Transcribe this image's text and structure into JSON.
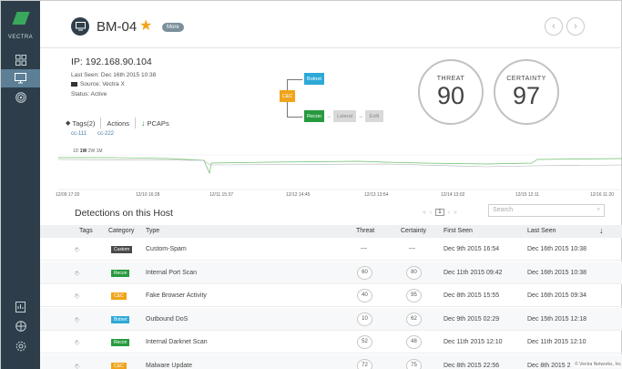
{
  "brand": {
    "name": "VECTRA"
  },
  "header": {
    "host_name": "BM-04",
    "more_label": "More",
    "star_icon": "star-icon",
    "prev_icon": "chevron-left-icon",
    "next_icon": "chevron-right-icon"
  },
  "host": {
    "ip": "IP: 192.168.90.104",
    "last_seen": "Last Seen: Dec 16th 2015 10:38",
    "source": "Source: Vectra X",
    "status": "Status: Active",
    "tags_label": "Tags(2)",
    "actions_label": "Actions",
    "pcaps_label": "PCAPs",
    "tags": [
      "cc-111",
      "cc-222"
    ]
  },
  "flow": {
    "nodes": {
      "cc": "C&C",
      "botnet": "Botnet",
      "recon": "Recon",
      "lateral": "Lateral",
      "exfil": "Exfil"
    },
    "colors": {
      "cc": "#f0a419",
      "botnet": "#2da9d8",
      "recon": "#279a3f",
      "inactive": "#d9d9d9"
    }
  },
  "scores": {
    "threat_label": "THREAT",
    "threat": "90",
    "certainty_label": "CERTAINTY",
    "certainty": "97"
  },
  "timeline": {
    "ranges": [
      "1D",
      "1W",
      "2W",
      "1M"
    ],
    "active_range": "1W",
    "ticks": [
      "12/09 17:20",
      "12/10 16:28",
      "12/11 15:37",
      "12/12 14:45",
      "12/13 13:54",
      "12/14 13:02",
      "12/15 12:11",
      "12/16 11:20"
    ]
  },
  "detections": {
    "title": "Detections on this Host",
    "search_placeholder": "Search",
    "page": "1",
    "columns": [
      "Tags",
      "Category",
      "Type",
      "Threat",
      "Certainty",
      "First Seen",
      "Last Seen"
    ],
    "rows": [
      {
        "tag": "+",
        "category": "Custom",
        "category_color": "#4a4a4a",
        "type": "Custom-Spam",
        "threat": "---",
        "certainty": "---",
        "first_seen": "Dec 9th 2015 16:54",
        "last_seen": "Dec 16th 2015 10:38"
      },
      {
        "tag": "+",
        "category": "Recon",
        "category_color": "#279a3f",
        "type": "Internal Port Scan",
        "threat": "60",
        "certainty": "80",
        "first_seen": "Dec 11th 2015 09:42",
        "last_seen": "Dec 16th 2015 10:38"
      },
      {
        "tag": "+",
        "category": "C&C",
        "category_color": "#f0a419",
        "type": "Fake Browser Activity",
        "threat": "40",
        "certainty": "95",
        "first_seen": "Dec 8th 2015 15:55",
        "last_seen": "Dec 16th 2015 09:34"
      },
      {
        "tag": "+",
        "category": "Botnet",
        "category_color": "#2da9d8",
        "type": "Outbound DoS",
        "threat": "10",
        "certainty": "62",
        "first_seen": "Dec 9th 2015 02:29",
        "last_seen": "Dec 15th 2015 12:18"
      },
      {
        "tag": "+",
        "category": "Recon",
        "category_color": "#279a3f",
        "type": "Internal Darknet Scan",
        "threat": "52",
        "certainty": "48",
        "first_seen": "Dec 11th 2015 12:10",
        "last_seen": "Dec 11th 2015 12:10"
      },
      {
        "tag": "+",
        "category": "C&C",
        "category_color": "#f0a419",
        "type": "Malware Update",
        "threat": "72",
        "certainty": "75",
        "first_seen": "Dec 8th 2015 22:56",
        "last_seen": "Dec 8th 2015 2"
      }
    ]
  },
  "footer": {
    "copyright": "© Vectra Networks, Inc"
  }
}
